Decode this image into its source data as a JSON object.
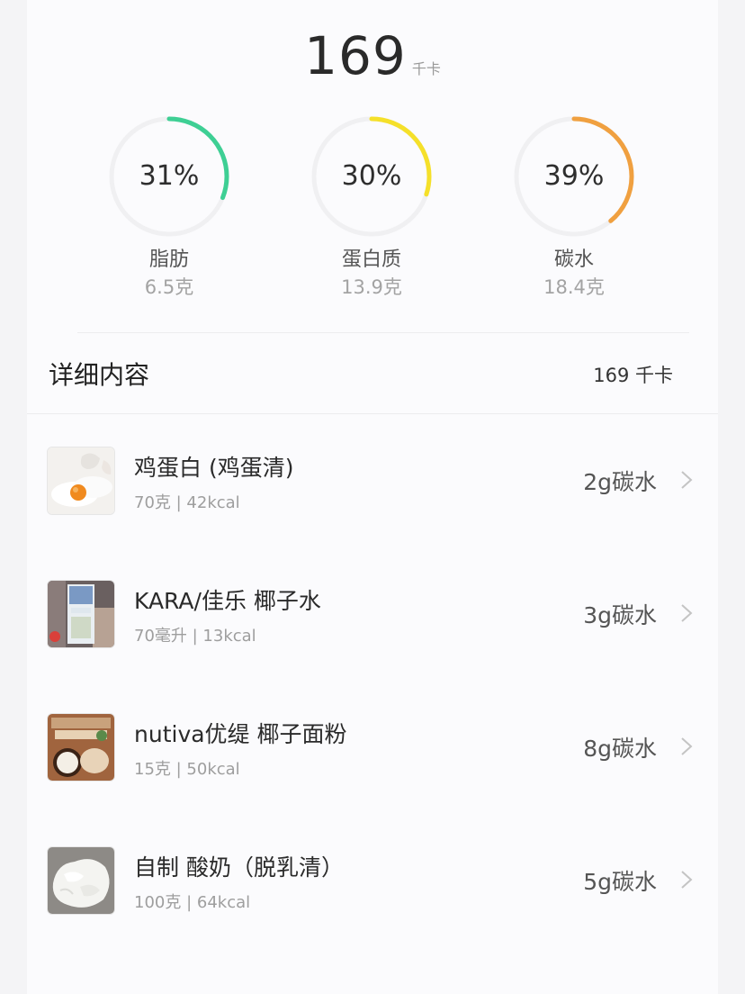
{
  "summary": {
    "total_calories": "169",
    "total_unit": "千卡"
  },
  "macros": [
    {
      "key": "fat",
      "percent_label": "31%",
      "fraction": 0.31,
      "color": "#3ecf94",
      "name": "脂肪",
      "amount": "6.5克"
    },
    {
      "key": "protein",
      "percent_label": "30%",
      "fraction": 0.3,
      "color": "#f5e02a",
      "name": "蛋白质",
      "amount": "13.9克"
    },
    {
      "key": "carbs",
      "percent_label": "39%",
      "fraction": 0.39,
      "color": "#f0a040",
      "name": "碳水",
      "amount": "18.4克"
    }
  ],
  "ring_track_color": "#f0f0f2",
  "details": {
    "title": "详细内容",
    "total": "169 千卡"
  },
  "foods": [
    {
      "name": "鸡蛋白 (鸡蛋清)",
      "meta": "70克 | 42kcal",
      "carb": "2g碳水",
      "thumb_icon": "egg-white-photo"
    },
    {
      "name": "KARA/佳乐 椰子水",
      "meta": "70毫升 | 13kcal",
      "carb": "3g碳水",
      "thumb_icon": "coconut-water-carton-photo"
    },
    {
      "name": "nutiva优缇 椰子面粉",
      "meta": "15克 | 50kcal",
      "carb": "8g碳水",
      "thumb_icon": "coconut-flour-bag-photo"
    },
    {
      "name": "自制 酸奶（脱乳清）",
      "meta": "100克 | 64kcal",
      "carb": "5g碳水",
      "thumb_icon": "strained-yogurt-photo"
    }
  ]
}
